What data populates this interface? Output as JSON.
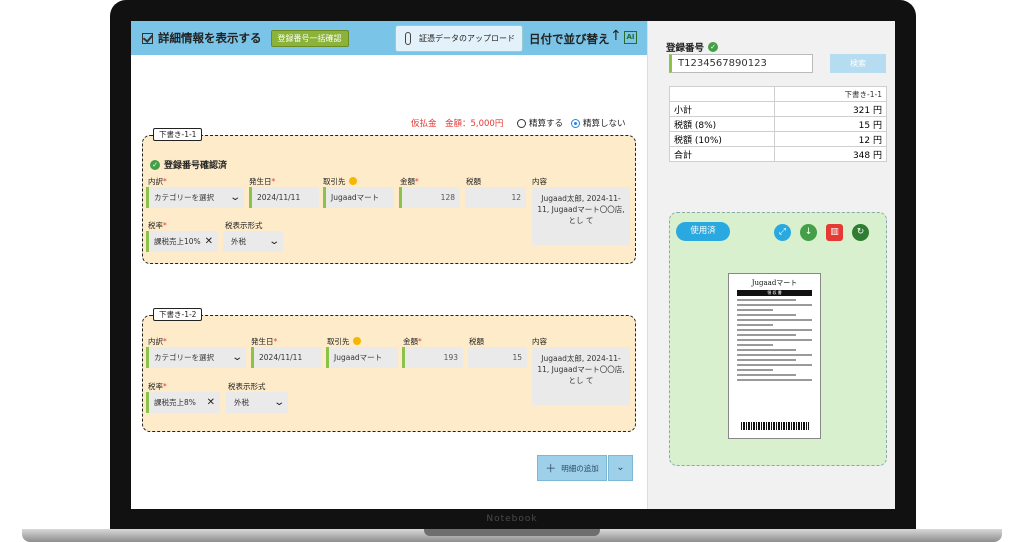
{
  "toolbar": {
    "show_details_label": "詳細情報を表示する",
    "bulk_check_label": "登録番号一括確認",
    "upload_label": "証憑データのアップロード",
    "sort_label": "日付で並び替え",
    "sort_arrow": "↑",
    "sort_icon_text": "AI"
  },
  "advance": {
    "text": "仮払金　金額：5,000円",
    "option_settled": "精算する",
    "option_unsettled": "精算しない",
    "selected": "精算しない"
  },
  "labels": {
    "category": "内訳",
    "date": "発生日",
    "partner": "取引先",
    "amount": "金額",
    "tax": "税額",
    "memo": "内容",
    "tax_rate": "税率",
    "tax_display": "税表示形式"
  },
  "entries": [
    {
      "tag": "下書き-1-1",
      "verified": "登録番号確認済",
      "category_placeholder": "カテゴリーを選択",
      "date": "2024/11/11",
      "partner": "Jugaadマート",
      "amount": "128",
      "tax": "12",
      "memo": "Jugaad太郎, 2024-11-11, Jugaadマート〇〇店,とし て",
      "tax_rate": "課税売上10%",
      "tax_display": "外税"
    },
    {
      "tag": "下書き-1-2",
      "category_placeholder": "カテゴリーを選択",
      "date": "2024/11/11",
      "partner": "Jugaadマート",
      "amount": "193",
      "tax": "15",
      "memo": "Jugaad太郎, 2024-11-11, Jugaadマート〇〇店,とし て",
      "tax_rate": "課税売上8%",
      "tax_display": "外税"
    }
  ],
  "add_detail_label": "明細の追加",
  "right": {
    "reg_label": "登録番号",
    "reg_value": "T1234567890123",
    "search_label": "検索",
    "summary_header": "下書き-1-1",
    "summary": [
      {
        "label": "小計",
        "value": "321 円"
      },
      {
        "label": "税額 (8%)",
        "value": "15 円"
      },
      {
        "label": "税額 (10%)",
        "value": "12 円"
      },
      {
        "label": "合計",
        "value": "348 円"
      }
    ],
    "used_label": "使用済",
    "receipt_title": "Jugaadマート",
    "receipt_head": "領 収 書"
  },
  "laptop_brand": "Notebook",
  "colors": {
    "toolbar": "#7ac4e8",
    "card_bg": "#fdebc9",
    "accent_green": "#8bc34a",
    "warning_red": "#e53935",
    "used_blue": "#29a9e0"
  }
}
